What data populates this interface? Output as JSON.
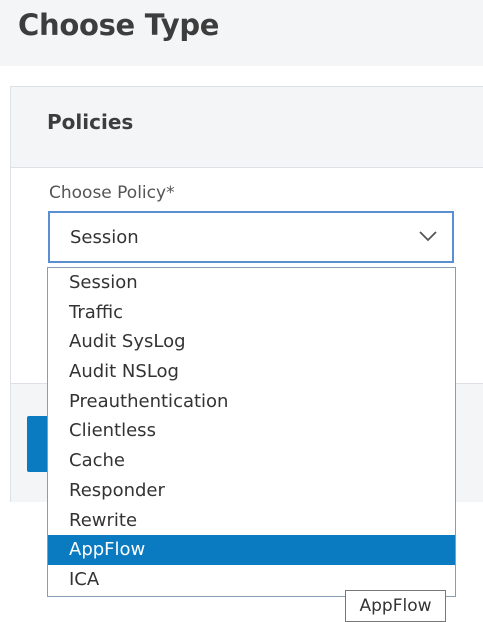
{
  "page": {
    "title": "Choose Type"
  },
  "panel": {
    "title": "Policies"
  },
  "field": {
    "label": "Choose Policy*",
    "selected_value": "Session"
  },
  "dropdown": {
    "highlighted": "AppFlow",
    "options": [
      {
        "label": "Session"
      },
      {
        "label": "Traffic"
      },
      {
        "label": "Audit SysLog"
      },
      {
        "label": "Audit NSLog"
      },
      {
        "label": "Preauthentication"
      },
      {
        "label": "Clientless"
      },
      {
        "label": "Cache"
      },
      {
        "label": "Responder"
      },
      {
        "label": "Rewrite"
      },
      {
        "label": "AppFlow"
      },
      {
        "label": "ICA"
      }
    ]
  },
  "tooltip": {
    "text": "AppFlow"
  },
  "icons": {
    "select_toggle": "chevron-down-icon"
  },
  "colors": {
    "accent": "#0a7bc1",
    "select_border": "#5a8fd4",
    "header_background": "#f4f5f7"
  }
}
